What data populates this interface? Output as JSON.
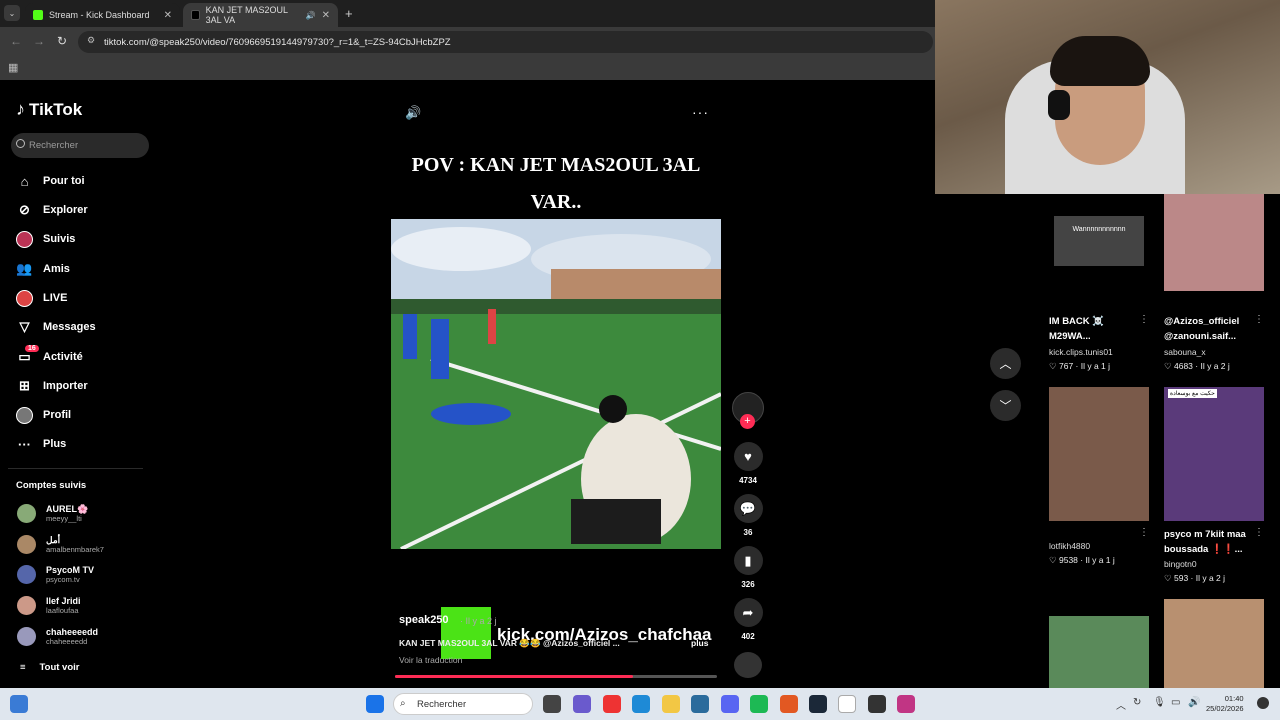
{
  "browser": {
    "tabs": [
      {
        "label": "Stream - Kick Dashboard"
      },
      {
        "label": "KAN JET MAS2OUL 3AL VA"
      }
    ],
    "url": "tiktok.com/@speak250/video/7609669519144979730?_r=1&_t=ZS-94CbJHcbZPZ"
  },
  "sidebar": {
    "logo": "TikTok",
    "search_placeholder": "Rechercher",
    "items": [
      {
        "label": "Pour toi",
        "icon": "home-icon"
      },
      {
        "label": "Explorer",
        "icon": "compass-icon"
      },
      {
        "label": "Suivis",
        "icon": "following-avatar-icon"
      },
      {
        "label": "Amis",
        "icon": "friends-icon"
      },
      {
        "label": "LIVE",
        "icon": "live-avatar-icon"
      },
      {
        "label": "Messages",
        "icon": "messages-icon"
      },
      {
        "label": "Activité",
        "icon": "activity-icon",
        "badge": "16"
      },
      {
        "label": "Importer",
        "icon": "upload-icon"
      },
      {
        "label": "Profil",
        "icon": "profile-icon"
      },
      {
        "label": "Plus",
        "icon": "more-icon"
      }
    ],
    "followed_title": "Comptes suivis",
    "accounts": [
      {
        "name": "AUREL🌸",
        "handle": "meeyy__lti"
      },
      {
        "name": "أمل",
        "handle": "amalbenmbarek7"
      },
      {
        "name": "PsycoM TV",
        "handle": "psycom.tv"
      },
      {
        "name": "Ilef Jridi",
        "handle": "laafloufaa"
      },
      {
        "name": "chaheeeedd",
        "handle": "chaheeeedd"
      }
    ],
    "see_all": "Tout voir"
  },
  "video": {
    "title": "POV : KAN JET MAS2OUL 3AL VAR..",
    "author": "speak250",
    "ago": "· Il y a 2 j",
    "caption": "KAN JET MAS2OUL 3AL VAR 😂😂 @Azizos_officiel ...",
    "more": "plus",
    "translate": "Voir la traduction",
    "watermark": "kick.com/Azizos_chafchaa",
    "progress": 0.74,
    "accent": "#fe2c55"
  },
  "actions": {
    "likes": "4734",
    "comments": "36",
    "saves": "326",
    "shares": "402"
  },
  "feed": [
    {
      "title": "IM BACK ☠️ M29WA...",
      "user": "kick.clips.tunis01",
      "likes": "767",
      "ago": "· Il y a 1 j",
      "overlay": "Wannnnnnnnnnn"
    },
    {
      "title": "@Azizos_officiel @zanouni.saif...",
      "user": "sabouna_x",
      "likes": "4683",
      "ago": "· Il y a 2 j"
    },
    {
      "title": "",
      "user": "lotfikh4880",
      "likes": "9538",
      "ago": "· Il y a 1 j"
    },
    {
      "title": "psyco m 7kiit maa boussada ❗❗...",
      "user": "bingotn0",
      "likes": "593",
      "ago": "· Il y a 2 j",
      "overlay": "حكيت مع بوسعادة"
    }
  ],
  "taskbar": {
    "search": "Rechercher",
    "time": "01:40",
    "date": "25/02/2026"
  }
}
